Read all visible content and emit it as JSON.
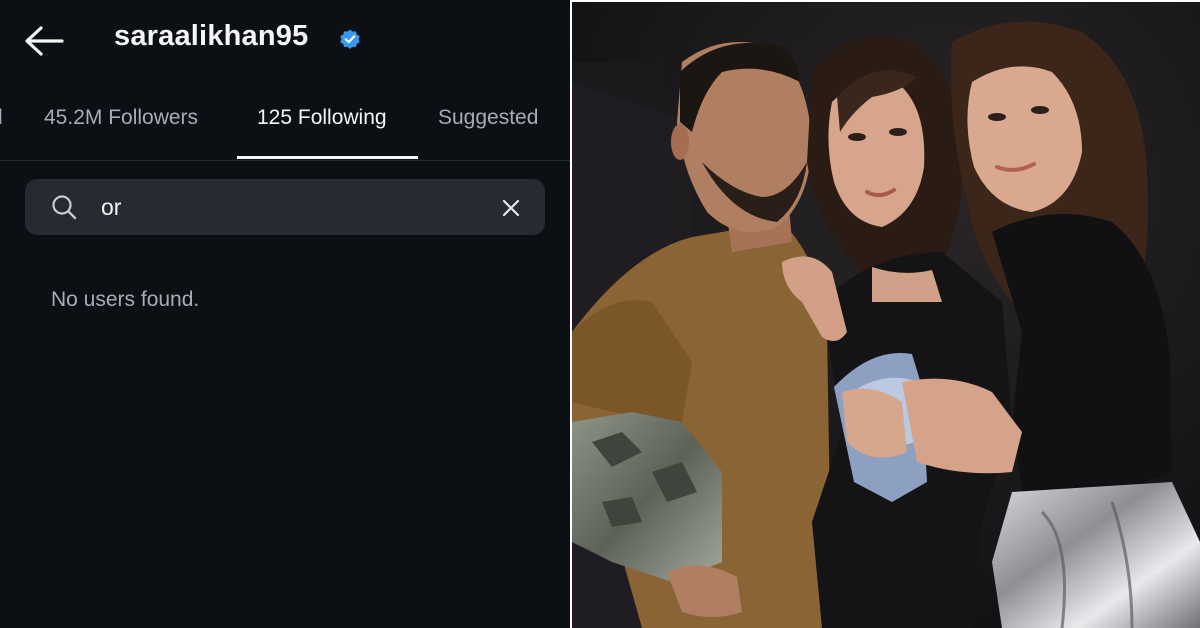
{
  "header": {
    "username": "saraalikhan95",
    "back_icon": "arrow-left-icon",
    "verified_icon": "verified-badge-icon",
    "verified_color": "#3897f0"
  },
  "tabs": [
    {
      "label": "l",
      "active": false
    },
    {
      "label": "45.2M Followers",
      "active": false
    },
    {
      "label": "125 Following",
      "active": true
    },
    {
      "label": "Suggested",
      "active": false
    }
  ],
  "search": {
    "value": "or",
    "search_icon": "search-icon",
    "clear_icon": "close-icon"
  },
  "results": {
    "empty_message": "No users found."
  },
  "photo": {
    "subject": "three people posing together at night"
  },
  "colors": {
    "background": "#0c0f14",
    "search_background": "#262a31",
    "text_primary": "#f5f5f5",
    "text_secondary": "#a8adb5"
  }
}
